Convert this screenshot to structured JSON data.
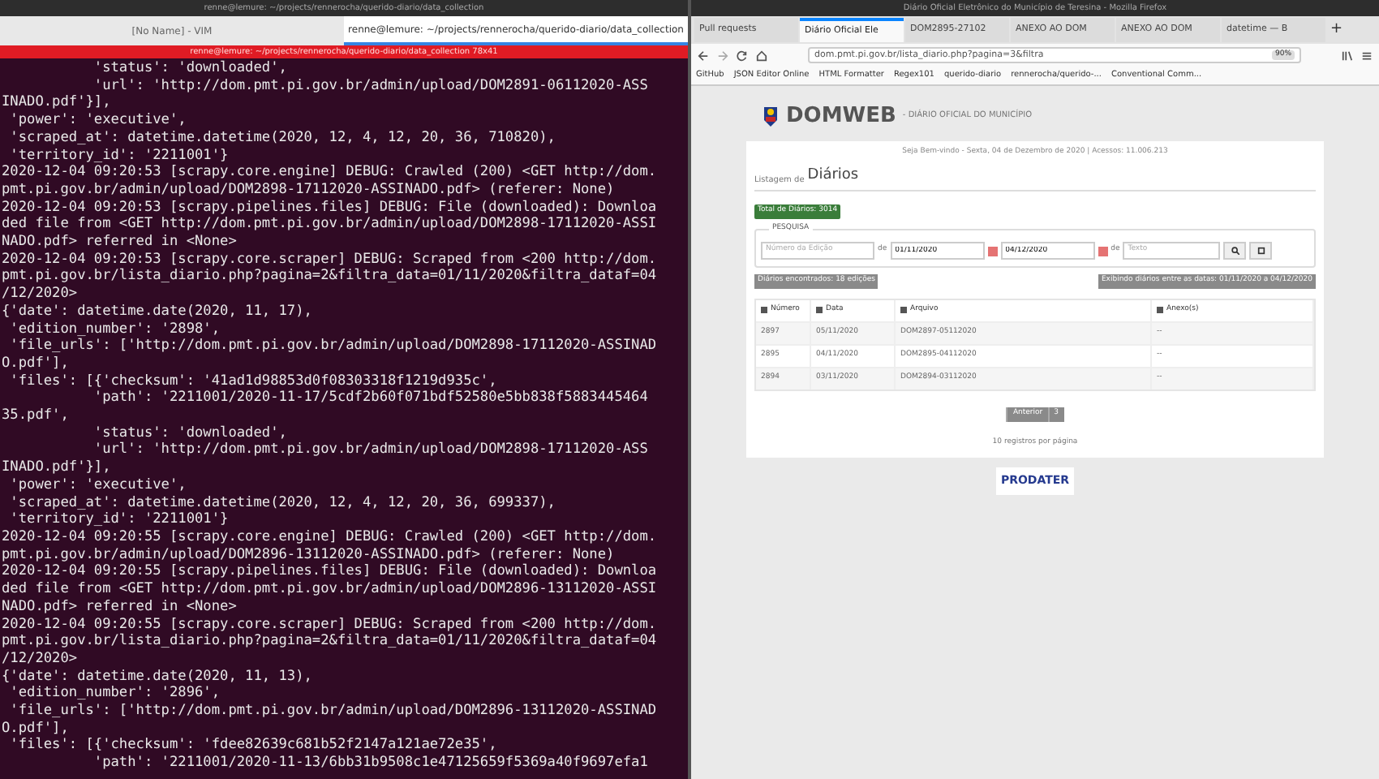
{
  "terminal": {
    "window_title": "renne@lemure: ~/projects/rennerocha/querido-diario/data_collection",
    "tabs": [
      {
        "label": "[No Name] - VIM",
        "selected": false
      },
      {
        "label": "renne@lemure: ~/projects/rennerocha/querido-diario/data_collection",
        "selected": true
      }
    ],
    "title_bar": "renne@lemure: ~/projects/rennerocha/querido-diario/data_collection 78x41",
    "lines": [
      "           'status': 'downloaded',",
      "           'url': 'http://dom.pmt.pi.gov.br/admin/upload/DOM2891-06112020-ASS",
      "INADO.pdf'}],",
      " 'power': 'executive',",
      " 'scraped_at': datetime.datetime(2020, 12, 4, 12, 20, 36, 710820),",
      " 'territory_id': '2211001'}",
      "2020-12-04 09:20:53 [scrapy.core.engine] DEBUG: Crawled (200) <GET http://dom.",
      "pmt.pi.gov.br/admin/upload/DOM2898-17112020-ASSINADO.pdf> (referer: None)",
      "2020-12-04 09:20:53 [scrapy.pipelines.files] DEBUG: File (downloaded): Downloa",
      "ded file from <GET http://dom.pmt.pi.gov.br/admin/upload/DOM2898-17112020-ASSI",
      "NADO.pdf> referred in <None>",
      "2020-12-04 09:20:53 [scrapy.core.scraper] DEBUG: Scraped from <200 http://dom.",
      "pmt.pi.gov.br/lista_diario.php?pagina=2&filtra_data=01/11/2020&filtra_dataf=04",
      "/12/2020>",
      "{'date': datetime.date(2020, 11, 17),",
      " 'edition_number': '2898',",
      " 'file_urls': ['http://dom.pmt.pi.gov.br/admin/upload/DOM2898-17112020-ASSINAD",
      "O.pdf'],",
      " 'files': [{'checksum': '41ad1d98853d0f08303318f1219d935c',",
      "           'path': '2211001/2020-11-17/5cdf2b60f071bdf52580e5bb838f5883445464",
      "35.pdf',",
      "           'status': 'downloaded',",
      "           'url': 'http://dom.pmt.pi.gov.br/admin/upload/DOM2898-17112020-ASS",
      "INADO.pdf'}],",
      " 'power': 'executive',",
      " 'scraped_at': datetime.datetime(2020, 12, 4, 12, 20, 36, 699337),",
      " 'territory_id': '2211001'}",
      "2020-12-04 09:20:55 [scrapy.core.engine] DEBUG: Crawled (200) <GET http://dom.",
      "pmt.pi.gov.br/admin/upload/DOM2896-13112020-ASSINADO.pdf> (referer: None)",
      "2020-12-04 09:20:55 [scrapy.pipelines.files] DEBUG: File (downloaded): Downloa",
      "ded file from <GET http://dom.pmt.pi.gov.br/admin/upload/DOM2896-13112020-ASSI",
      "NADO.pdf> referred in <None>",
      "2020-12-04 09:20:55 [scrapy.core.scraper] DEBUG: Scraped from <200 http://dom.",
      "pmt.pi.gov.br/lista_diario.php?pagina=2&filtra_data=01/11/2020&filtra_dataf=04",
      "/12/2020>",
      "{'date': datetime.date(2020, 11, 13),",
      " 'edition_number': '2896',",
      " 'file_urls': ['http://dom.pmt.pi.gov.br/admin/upload/DOM2896-13112020-ASSINAD",
      "O.pdf'],",
      " 'files': [{'checksum': 'fdee82639c681b52f2147a121ae72e35',",
      "           'path': '2211001/2020-11-13/6bb31b9508c1e47125659f5369a40f9697efa1"
    ]
  },
  "browser": {
    "window_title": "Diário Oficial Eletrônico do Município de Teresina - Mozilla Firefox",
    "tabs": [
      {
        "label": "Pull requests",
        "selected": false
      },
      {
        "label": "Diário Oficial Ele",
        "selected": true
      },
      {
        "label": "DOM2895-27102",
        "selected": false
      },
      {
        "label": "ANEXO AO DOM",
        "selected": false
      },
      {
        "label": "ANEXO AO DOM",
        "selected": false
      },
      {
        "label": "datetime — B",
        "selected": false
      }
    ],
    "new_tab": "+",
    "url": "dom.pmt.pi.gov.br/lista_diario.php?pagina=3&filtra",
    "zoom": "90%",
    "bookmarks": [
      "GitHub",
      "JSON Editor Online",
      "HTML Formatter",
      "Regex101",
      "querido-diario",
      "rennerocha/querido-...",
      "Conventional Comm..."
    ],
    "site": {
      "brand": "DOMWEB",
      "tagline": "- DIÁRIO OFICIAL DO MUNICÍPIO",
      "welcome": "Seja Bem-vindo - Sexta, 04 de Dezembro de 2020 | Acessos: 11.006.213",
      "heading_prefix": "Listagem de",
      "heading": "Diários",
      "total_badge": "Total de Diários: 3014",
      "search_legend": "PESQUISA",
      "edition_placeholder": "Número da Edição",
      "from_label": "de",
      "date_from": "01/11/2020",
      "date_to": "04/12/2020",
      "text_label": "de",
      "text_placeholder": "Texto",
      "found_badge": "Diários encontrados: 18 edições",
      "range_badge": "Exibindo diários entre as datas: 01/11/2020 a 04/12/2020",
      "columns": [
        "Número",
        "Data",
        "Arquivo",
        "Anexo(s)"
      ],
      "rows": [
        [
          "2897",
          "05/11/2020",
          "DOM2897-05112020",
          "--"
        ],
        [
          "2895",
          "04/11/2020",
          "DOM2895-04112020",
          "--"
        ],
        [
          "2894",
          "03/11/2020",
          "DOM2894-03112020",
          "--"
        ]
      ],
      "pagination": [
        "Anterior",
        "3"
      ],
      "per_page": "10 registros por página",
      "footer_logo": "PRODATER"
    }
  }
}
